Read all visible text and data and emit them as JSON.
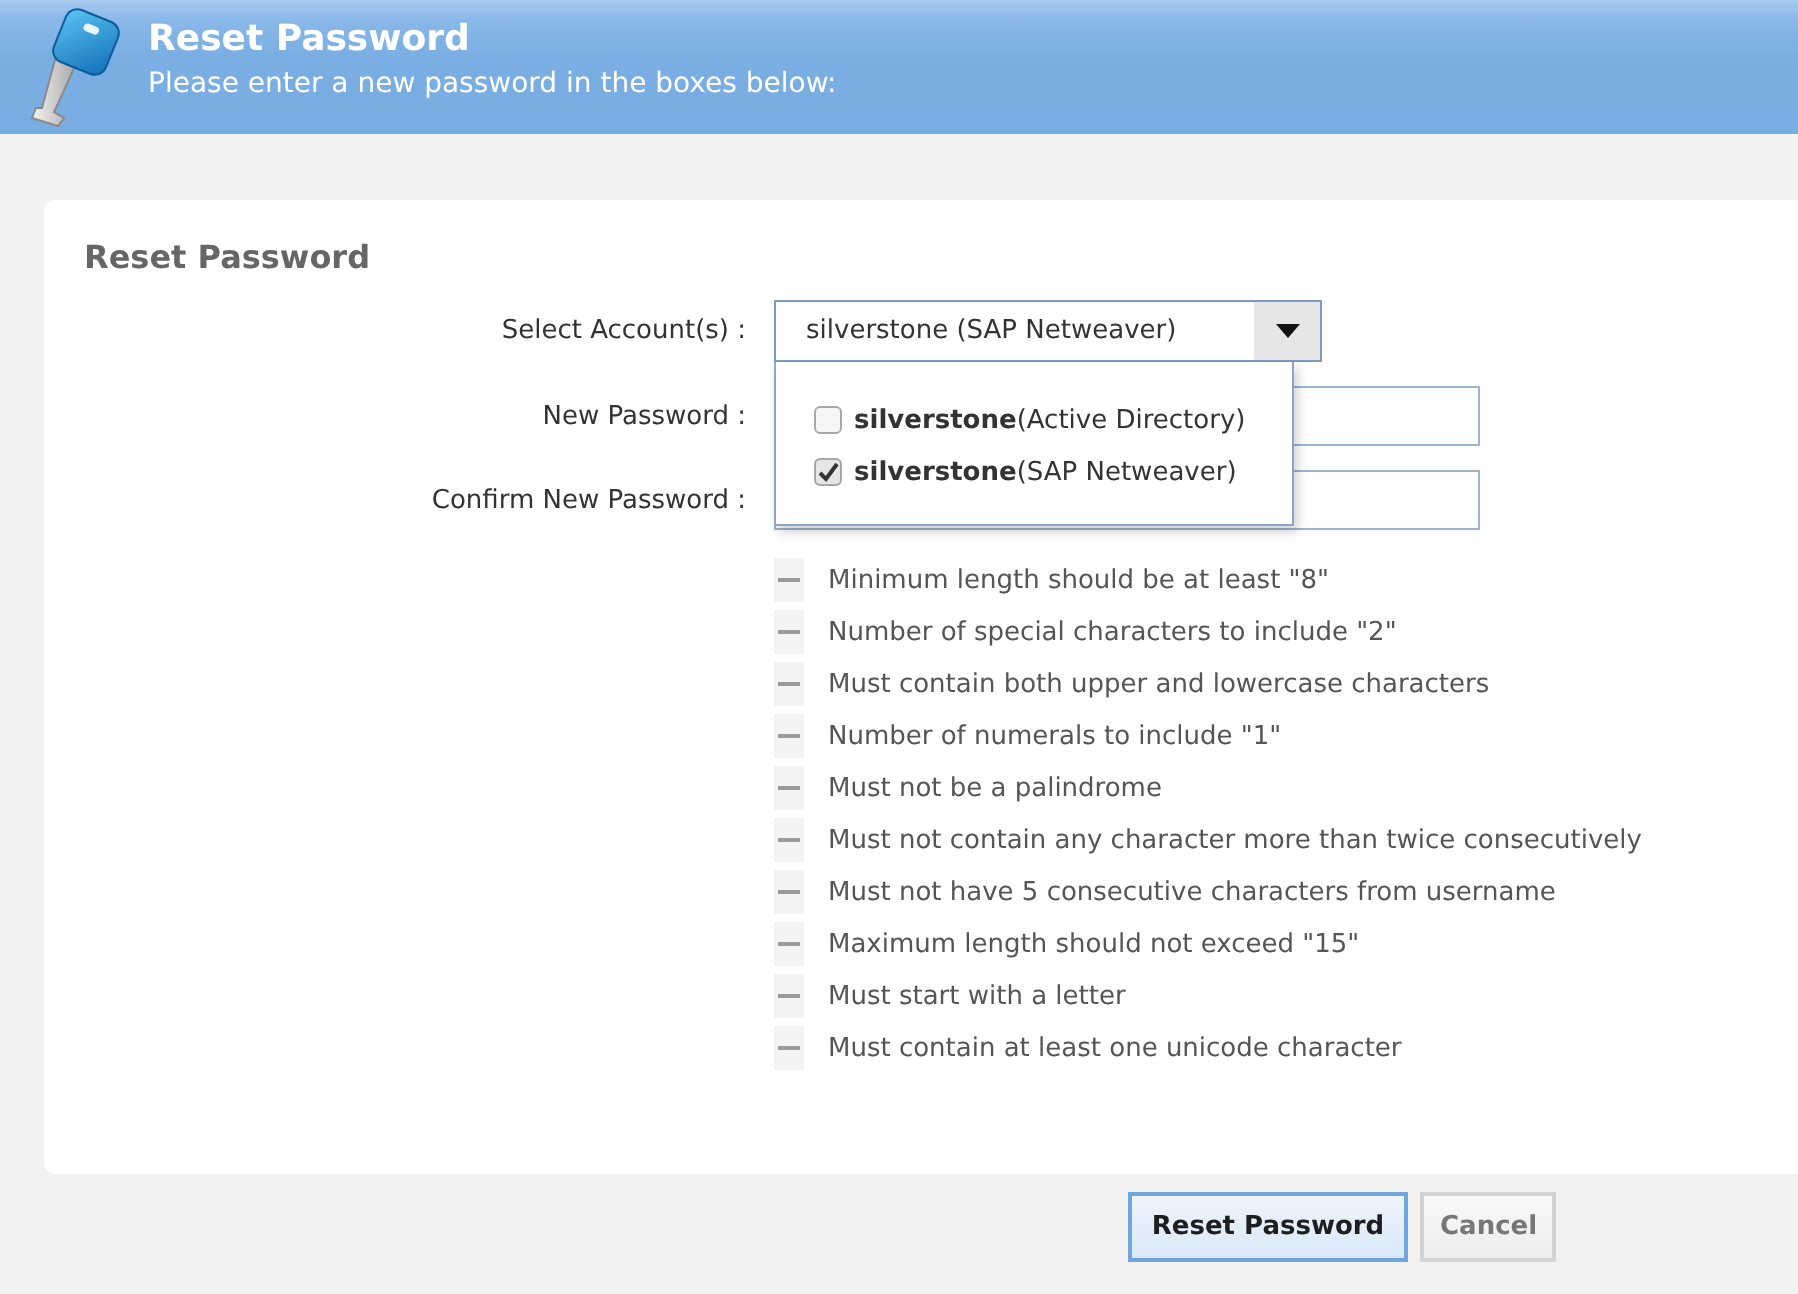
{
  "header": {
    "title": "Reset Password",
    "subtitle": "Please enter a new password in the boxes below:"
  },
  "form": {
    "title": "Reset Password",
    "fields": [
      {
        "kind": "select",
        "label": "Select Account(s) :",
        "value": "silverstone (SAP Netweaver)",
        "expanded": true
      },
      {
        "kind": "password",
        "label": "New Password :"
      },
      {
        "kind": "password",
        "label": "Confirm New Password :"
      }
    ]
  },
  "account_options": [
    {
      "label": "**silverstone**(Active Directory)",
      "checked": false
    },
    {
      "label": "**silverstone**(SAP Netweaver)",
      "checked": true
    }
  ],
  "rules": [
    "Minimum length should be at least \"8\"",
    "Number of special characters to include \"2\"",
    "Must contain both upper and lowercase characters",
    "Number of numerals to include \"1\"",
    "Must not be a palindrome",
    "Must not contain any character more than twice consecutively",
    "Must not have 5 consecutive characters from username",
    "Maximum length should not exceed \"15\"",
    "Must start with a letter",
    "Must contain at least one unicode character"
  ],
  "buttons": [
    {
      "label": "Reset Password",
      "kind": "primary"
    },
    {
      "label": "Cancel",
      "kind": "secondary"
    }
  ]
}
